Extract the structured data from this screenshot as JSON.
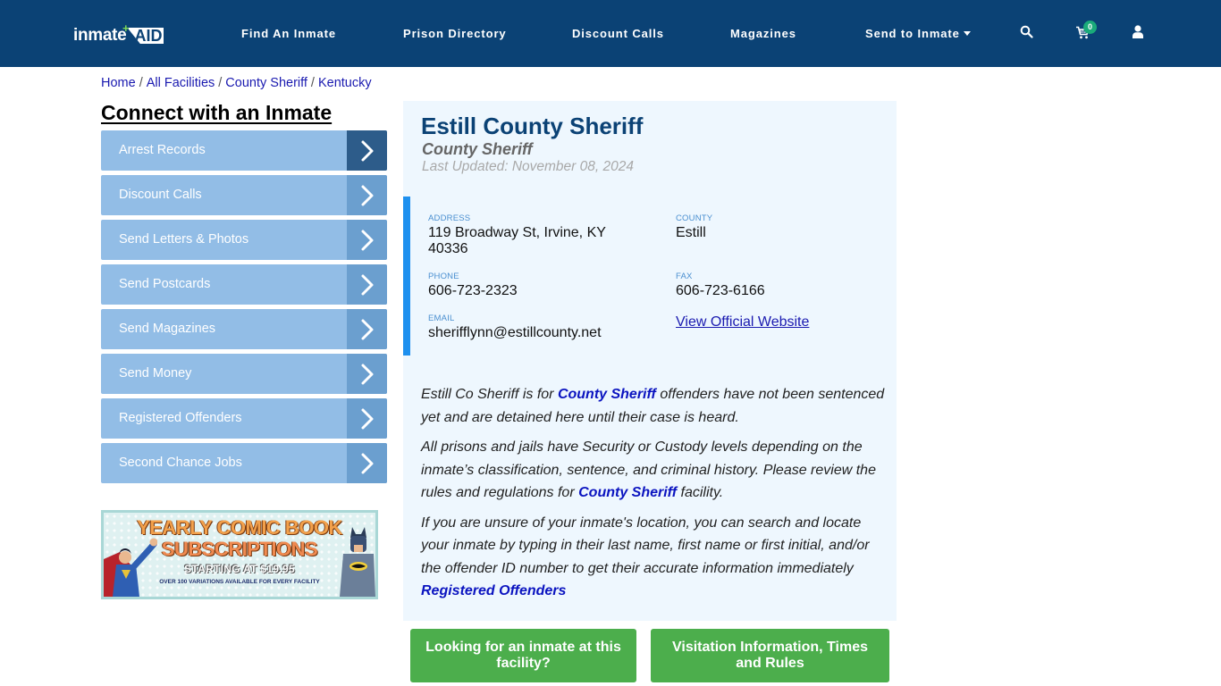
{
  "header": {
    "logo": {
      "part1": "inmate",
      "part2": "AID",
      "plus": "+"
    },
    "nav": [
      {
        "label": "Find An Inmate"
      },
      {
        "label": "Prison Directory"
      },
      {
        "label": "Discount Calls"
      },
      {
        "label": "Magazines"
      },
      {
        "label": "Send to Inmate",
        "has_dropdown": true
      }
    ],
    "icons": [
      "search-icon",
      "cart-icon",
      "user-icon"
    ],
    "cart_count": "0",
    "colors": {
      "background": "#0b4275",
      "badge": "#1aaa7a"
    }
  },
  "breadcrumb": [
    {
      "label": "Home"
    },
    {
      "label": "All Facilities"
    },
    {
      "label": "County Sheriff"
    },
    {
      "label": "Kentucky"
    }
  ],
  "breadcrumb_separator": "/",
  "sidebar": {
    "title": "Connect with an Inmate",
    "items": [
      {
        "label": "Arrest Records"
      },
      {
        "label": "Discount Calls"
      },
      {
        "label": "Send Letters & Photos"
      },
      {
        "label": "Send Postcards"
      },
      {
        "label": "Send Magazines"
      },
      {
        "label": "Send Money"
      },
      {
        "label": "Registered Offenders"
      },
      {
        "label": "Second Chance Jobs"
      }
    ],
    "banner": {
      "line1": "YEARLY COMIC BOOK",
      "line2": "SUBSCRIPTIONS",
      "line3": "STARTING AT $19.95",
      "line4": "OVER 100 VARIATIONS AVAILABLE FOR EVERY FACILITY"
    }
  },
  "facility": {
    "name": "Estill County Sheriff",
    "type": "County Sheriff",
    "last_updated": "Last Updated: November 08, 2024",
    "fields": {
      "address": {
        "label": "ADDRESS",
        "value": "119 Broadway St, Irvine, KY 40336"
      },
      "county": {
        "label": "COUNTY",
        "value": "Estill"
      },
      "phone": {
        "label": "PHONE",
        "value": "606-723-2323"
      },
      "fax": {
        "label": "FAX",
        "value": "606-723-6166"
      },
      "email": {
        "label": "EMAIL",
        "value": "sherifflynn@estillcounty.net"
      },
      "website": {
        "label": "View Official Website"
      }
    },
    "description": {
      "p1": {
        "before": "Estill Co Sheriff is for ",
        "link": "County Sheriff",
        "after": " offenders have not been sentenced yet and are detained here until their case is heard."
      },
      "p2": {
        "before": "All prisons and jails have Security or Custody levels depending on the inmate’s classification, sentence, and criminal history. Please review the rules and regulations for ",
        "link": "County Sheriff",
        "after": " facility."
      },
      "p3": {
        "text": "If you are unsure of your inmate's location, you can search and locate your inmate by typing in their last name, first name or first initial, and/or the offender ID number to get their accurate information immediately",
        "link": "Registered Offenders"
      }
    }
  },
  "actions": [
    {
      "label": "Looking for an inmate at this facility?"
    },
    {
      "label": "Visitation Information, Times and Rules"
    }
  ]
}
